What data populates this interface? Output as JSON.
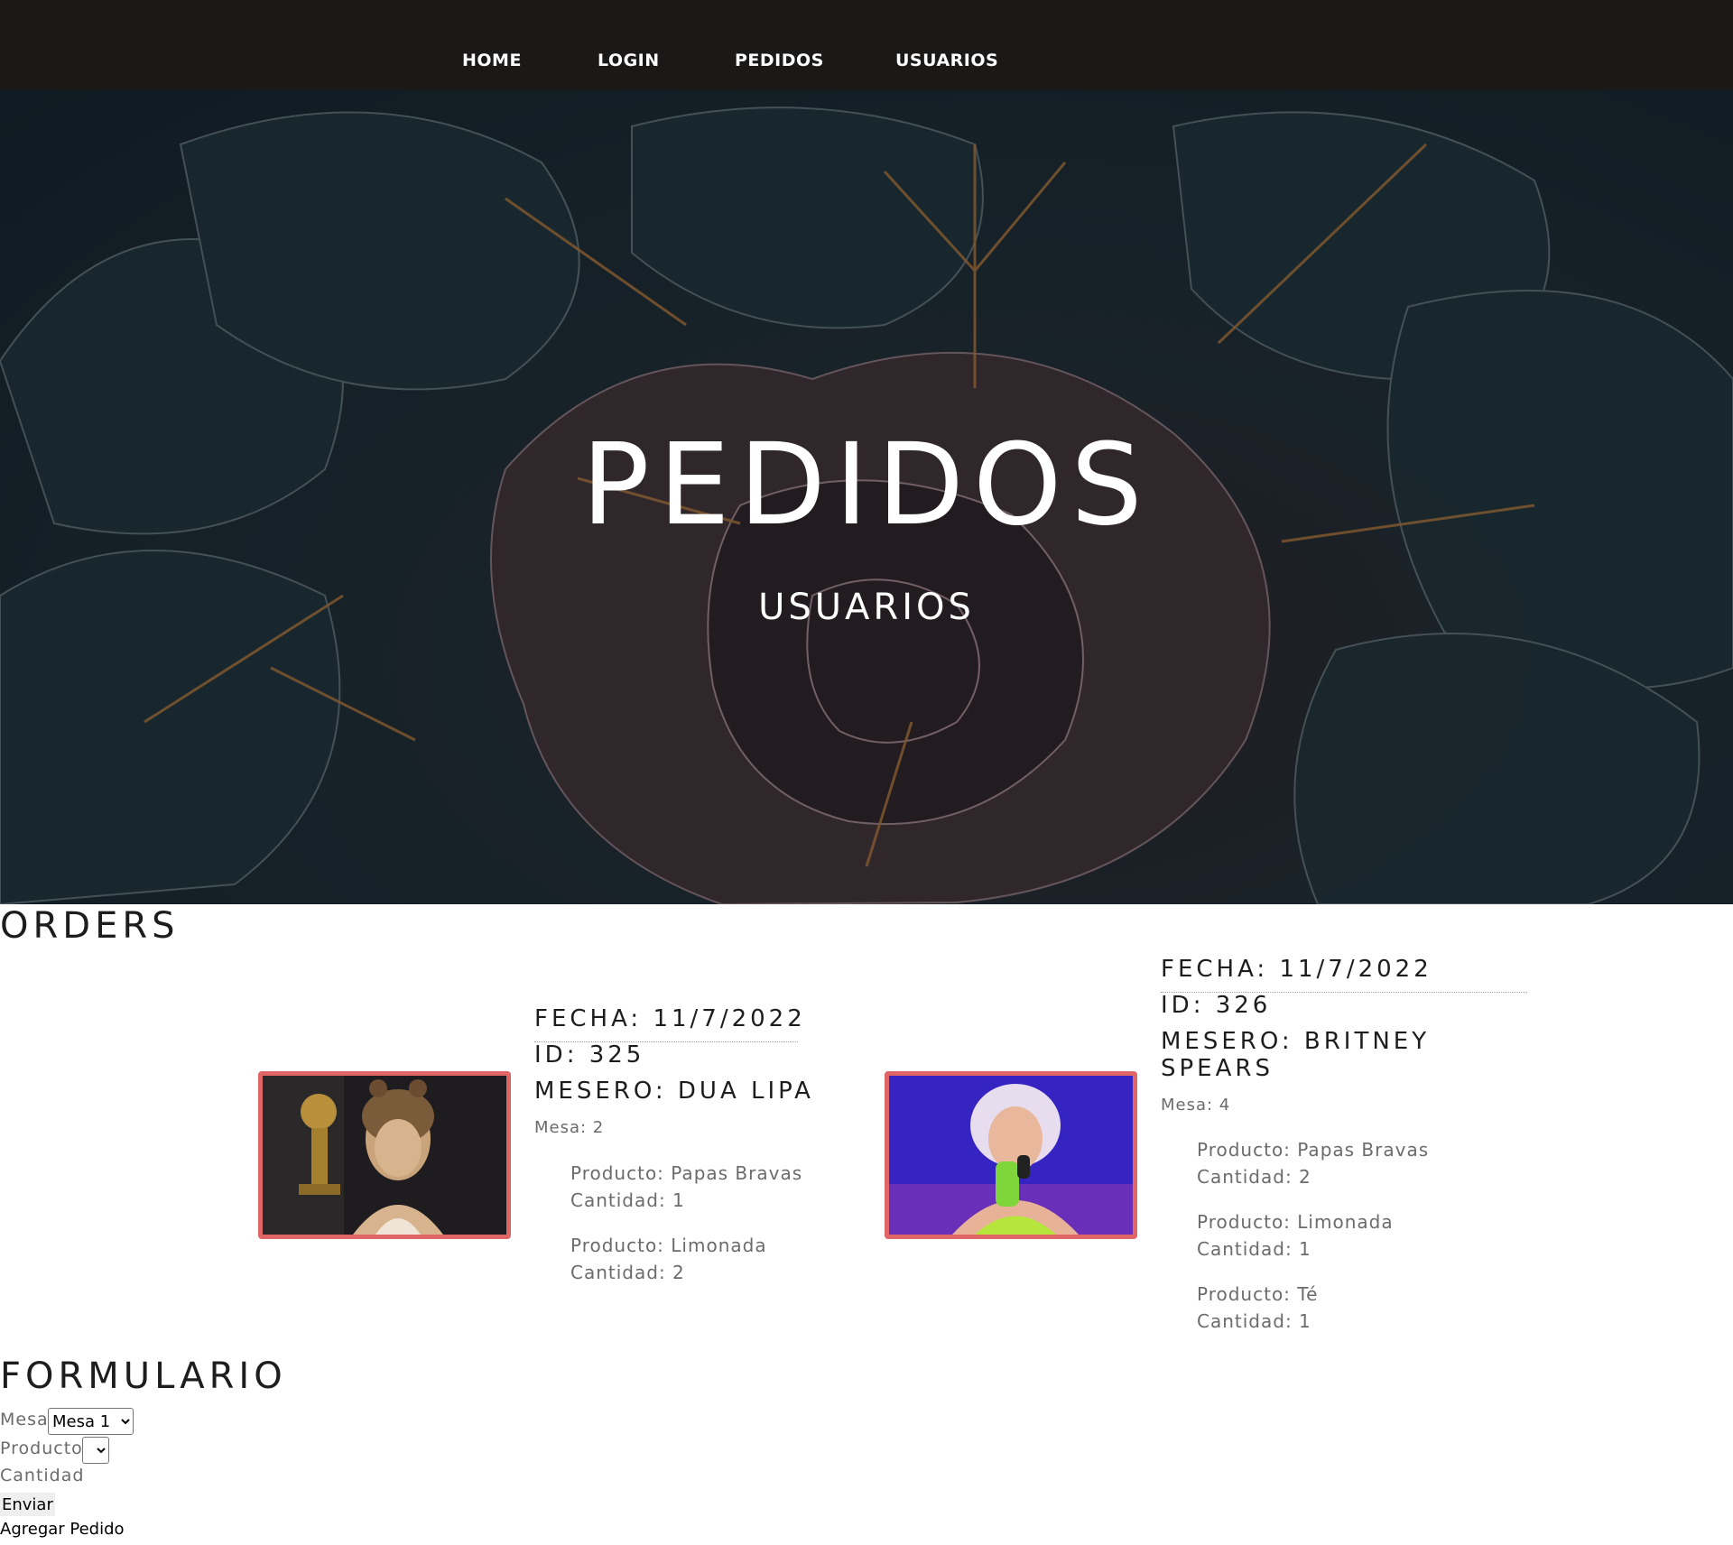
{
  "nav": {
    "items": [
      "HOME",
      "LOGIN",
      "PEDIDOS",
      "USUARIOS"
    ]
  },
  "hero": {
    "title": "PEDIDOS",
    "subtitle": "USUARIOS"
  },
  "orders": {
    "title": "ORDERS",
    "list": [
      {
        "fecha": "FECHA: 11/7/2022",
        "id": "ID: 325",
        "mesero": "MESERO: DUA LIPA",
        "mesa": "Mesa: 2",
        "products": [
          {
            "producto": "Producto: Papas Bravas",
            "cantidad": "Cantidad: 1"
          },
          {
            "producto": "Producto: Limonada",
            "cantidad": "Cantidad: 2"
          }
        ]
      },
      {
        "fecha": "FECHA: 11/7/2022",
        "id": "ID: 326",
        "mesero_line1": "MESERO: BRITNEY",
        "mesero_line2": "SPEARS",
        "mesa": "Mesa: 4",
        "products": [
          {
            "producto": "Producto: Papas Bravas",
            "cantidad": "Cantidad: 2"
          },
          {
            "producto": "Producto: Limonada",
            "cantidad": "Cantidad: 1"
          },
          {
            "producto": "Producto: Té",
            "cantidad": "Cantidad: 1"
          }
        ]
      }
    ]
  },
  "form": {
    "title": "FORMULARIO",
    "mesa_label": "Mesa",
    "mesa_selected": "Mesa 1",
    "producto_label": "Producto",
    "producto_selected": "",
    "cantidad_label": "Cantidad",
    "submit_label": "Enviar",
    "add_link": "Agregar Pedido"
  },
  "colors": {
    "navbar": "#1b1818",
    "photo_border": "#e06565",
    "muted_text": "#6b6b6b"
  }
}
